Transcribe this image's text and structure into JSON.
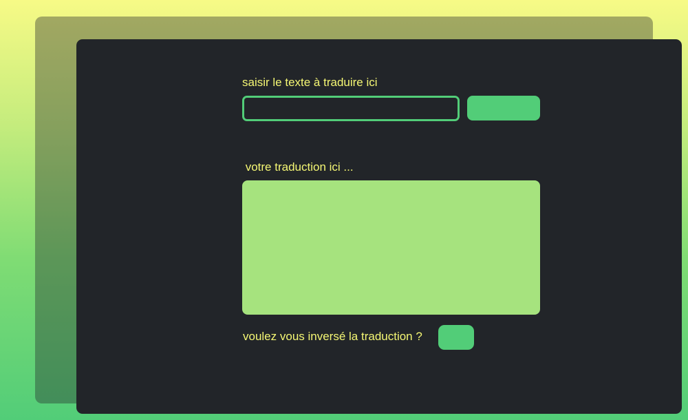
{
  "translator": {
    "input_label": "saisir le texte à traduire ici",
    "input_value": "",
    "input_placeholder": "",
    "translate_button_label": "",
    "output_label": " votre traduction ici ...",
    "output_text": "",
    "swap_question": "voulez vous inversé la traduction ?",
    "swap_button_label": ""
  },
  "colors": {
    "background_top": "#f7fa86",
    "background_bottom": "#52cd78",
    "panel": "#222529",
    "accent": "#52cd78",
    "output_box": "#a6e37e",
    "label_text": "#f5f774"
  }
}
